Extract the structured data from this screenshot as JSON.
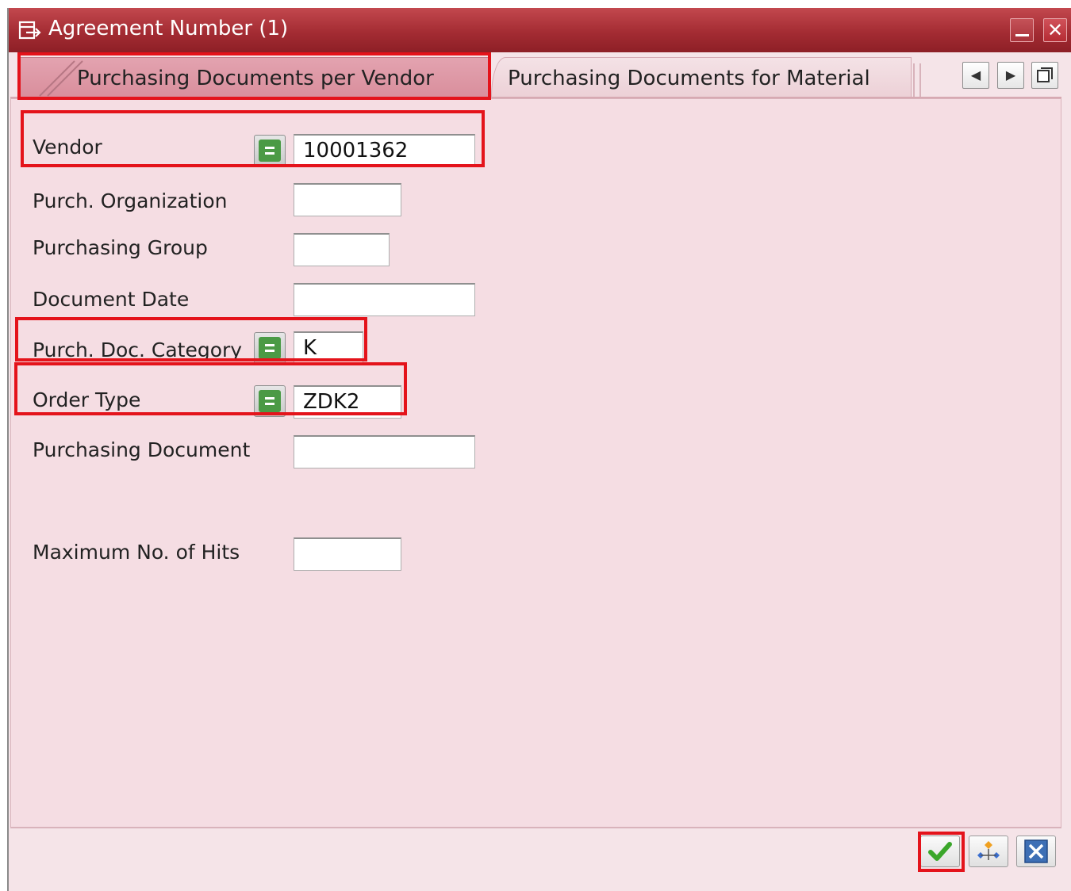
{
  "window": {
    "title": "Agreement Number (1)"
  },
  "titlebar_buttons": {
    "minimize": "minimize-icon",
    "close": "close-icon"
  },
  "tabs": [
    {
      "label": "Purchasing Documents per Vendor",
      "active": true
    },
    {
      "label": "Purchasing Documents for Material",
      "active": false
    }
  ],
  "tab_nav": [
    "scroll-left-icon",
    "scroll-right-icon",
    "tab-list-icon"
  ],
  "form": {
    "vendor": {
      "label": "Vendor",
      "value": "10001362",
      "operator": "equals"
    },
    "purch_org": {
      "label": "Purch. Organization",
      "value": ""
    },
    "purch_group": {
      "label": "Purchasing Group",
      "value": ""
    },
    "doc_date": {
      "label": "Document Date",
      "value": ""
    },
    "doc_category": {
      "label": "Purch. Doc. Category",
      "value": "K",
      "operator": "equals"
    },
    "order_type": {
      "label": "Order Type",
      "value": "ZDK2",
      "operator": "equals"
    },
    "purch_doc": {
      "label": "Purchasing Document",
      "value": ""
    },
    "max_hits": {
      "label": "Maximum No. of Hits",
      "value": ""
    }
  },
  "footer_buttons": [
    "continue-check-icon",
    "hierarchy-icon",
    "cancel-icon"
  ],
  "colors": {
    "titlebar": "#a42c33",
    "highlight": "#e4131b",
    "panel": "#f5dde3",
    "eq_green": "#4b9a45"
  }
}
